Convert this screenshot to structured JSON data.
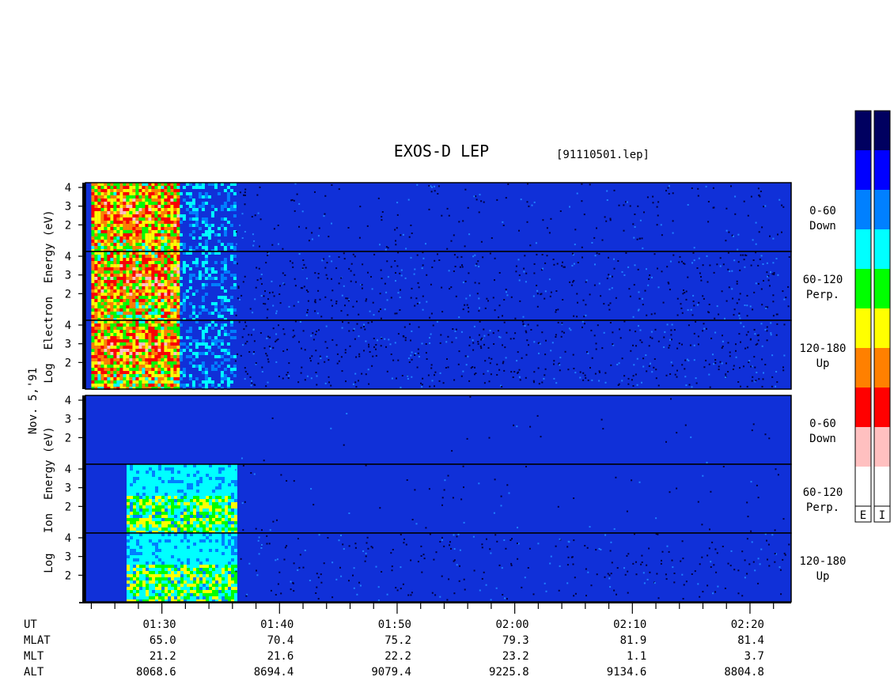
{
  "title": "EXOS-D LEP",
  "file_label": "[91110501.lep]",
  "date_label": "Nov. 5,'91",
  "electron_ylabel": "Log  Electron  Energy (eV)",
  "ion_ylabel": "Log   Ion  Energy (eV)",
  "colorbar": {
    "labels": [
      "E",
      "I"
    ],
    "colors": [
      "#000060",
      "#0000ff",
      "#0080ff",
      "#00ffff",
      "#00ff00",
      "#ffff00",
      "#ff8000",
      "#ff0000",
      "#ffc0c0",
      "#ffffff"
    ]
  },
  "ephemeris": {
    "row_labels": [
      "UT",
      "MLAT",
      "MLT",
      "ALT"
    ],
    "columns": [
      {
        "ut": "01:30",
        "mlat": "65.0",
        "mlt": "21.2",
        "alt": "8068.6"
      },
      {
        "ut": "01:40",
        "mlat": "70.4",
        "mlt": "21.6",
        "alt": "8694.4"
      },
      {
        "ut": "01:50",
        "mlat": "75.2",
        "mlt": "22.2",
        "alt": "9079.4"
      },
      {
        "ut": "02:00",
        "mlat": "79.3",
        "mlt": "23.2",
        "alt": "9225.8"
      },
      {
        "ut": "02:10",
        "mlat": "81.9",
        "mlt": "1.1",
        "alt": "9134.6"
      },
      {
        "ut": "02:20",
        "mlat": "81.4",
        "mlt": "3.7",
        "alt": "8804.8"
      }
    ]
  },
  "chart_data": {
    "type": "heatmap",
    "x_range_minutes_ut": [
      83.5,
      143.5
    ],
    "y_range_log_energy_ev": [
      1,
      4
    ],
    "y_ticks": [
      2,
      3,
      4
    ],
    "panels": [
      {
        "species": "electron",
        "pitch_line1": "0-60",
        "pitch_line2": "Down",
        "hot_end_ut_min": 91.5,
        "hot_start_ut_min": 84.0,
        "dropout_ut_min": 96.2,
        "sparse": 0.25
      },
      {
        "species": "electron",
        "pitch_line1": "60-120",
        "pitch_line2": "Perp.",
        "hot_end_ut_min": 91.5,
        "hot_start_ut_min": 84.0,
        "dropout_ut_min": 96.2,
        "sparse": 0.55
      },
      {
        "species": "electron",
        "pitch_line1": "120-180",
        "pitch_line2": "Up",
        "hot_end_ut_min": 91.5,
        "hot_start_ut_min": 84.0,
        "dropout_ut_min": 96.2,
        "sparse": 0.65
      },
      {
        "species": "ion",
        "pitch_line1": "0-60",
        "pitch_line2": "Down",
        "hot_end_ut_min": 84.0,
        "hot_start_ut_min": 84.0,
        "dropout_ut_min": 96.2,
        "sparse": 0.03
      },
      {
        "species": "ion",
        "pitch_line1": "60-120",
        "pitch_line2": "Perp.",
        "hot_end_ut_min": 96.2,
        "hot_start_ut_min": 87.0,
        "dropout_ut_min": 96.2,
        "sparse": 0.08
      },
      {
        "species": "ion",
        "pitch_line1": "120-180",
        "pitch_line2": "Up",
        "hot_end_ut_min": 96.2,
        "hot_start_ut_min": 87.0,
        "dropout_ut_min": 96.2,
        "sparse": 0.35
      }
    ]
  }
}
